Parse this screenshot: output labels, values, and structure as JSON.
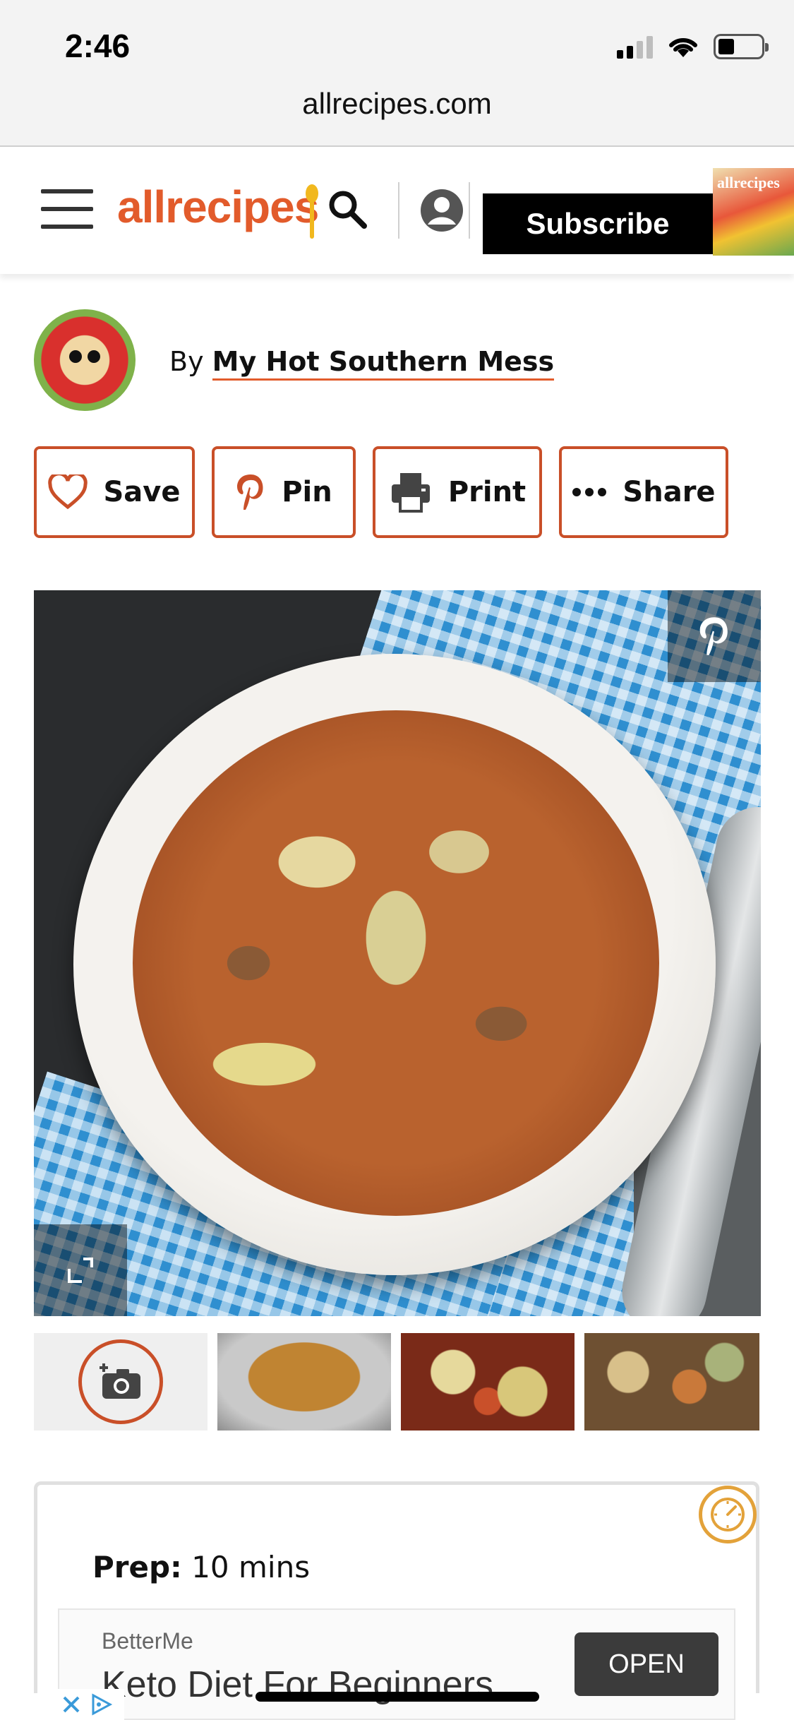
{
  "status_bar": {
    "time": "2:46"
  },
  "browser": {
    "url": "allrecipes.com"
  },
  "header": {
    "logo": "allrecipes",
    "subscribe_label": "Subscribe",
    "magazine_title": "allrecipes"
  },
  "author": {
    "prefix": "By",
    "name": "My Hot Southern Mess"
  },
  "actions": {
    "save_label": "Save",
    "pin_label": "Pin",
    "print_label": "Print",
    "share_label": "Share"
  },
  "recipe_info": {
    "prep_label": "Prep:",
    "prep_value": "10 mins"
  },
  "ad": {
    "brand": "BetterMe",
    "headline": "Keto Diet For Beginners",
    "cta": "OPEN"
  },
  "colors": {
    "brand_orange": "#e25b2b",
    "button_border": "#c94f28",
    "timer_accent": "#e3a23a"
  },
  "icons": [
    "hamburger-icon",
    "search-icon",
    "account-icon",
    "heart-icon",
    "pinterest-icon",
    "printer-icon",
    "more-icon",
    "expand-icon",
    "add-photo-icon",
    "timer-icon",
    "ad-close-icon",
    "ad-choices-icon"
  ]
}
